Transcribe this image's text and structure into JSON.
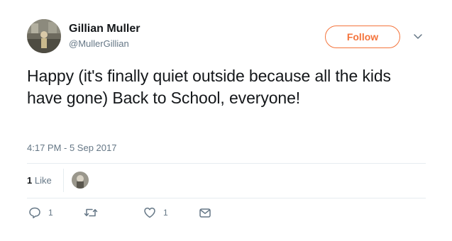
{
  "user": {
    "display_name": "Gillian Muller",
    "handle": "@MullerGillian"
  },
  "follow_label": "Follow",
  "tweet": {
    "text": "Happy (it's finally quiet outside because all the kids have gone) Back to School, everyone!",
    "timestamp": "4:17 PM - 5 Sep 2017"
  },
  "likes_summary": {
    "count": "1",
    "label": "Like"
  },
  "actions": {
    "reply_count": "1",
    "like_count": "1"
  },
  "icons": {
    "caret": "chevron-down-icon",
    "reply": "reply-icon",
    "retweet": "retweet-icon",
    "like": "heart-icon",
    "dm": "envelope-icon"
  },
  "colors": {
    "follow_accent": "#f4743c",
    "secondary_text": "#657786",
    "primary_text": "#14171a",
    "divider": "#e6ecf0"
  }
}
